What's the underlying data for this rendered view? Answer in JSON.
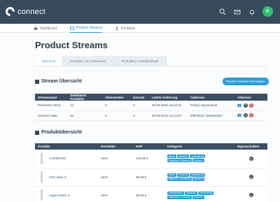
{
  "app": {
    "brand": "connect",
    "user_initial": "R"
  },
  "topbar_icons": [
    "search-icon",
    "mail-icon",
    "bell-icon"
  ],
  "nav": [
    {
      "label": "Dashboard",
      "icon": "home-icon",
      "active": false
    },
    {
      "label": "Product Streams",
      "icon": "stream-icon",
      "active": true
    },
    {
      "label": "Kontakte",
      "icon": "contacts-icon",
      "active": false
    }
  ],
  "page": {
    "title": "Product Streams"
  },
  "tabs": [
    {
      "label": "Übersicht",
      "active": true
    },
    {
      "label": "Produkte von Lieferanten",
      "active": false
    },
    {
      "label": "Produkte in Händlershops",
      "active": false
    }
  ],
  "stream_section": {
    "title": "Stream Übersicht",
    "add_button": "Product Stream hinzufügen",
    "columns": [
      "Streamname",
      "Selektierte Produkte",
      "Abonnenten",
      "Umsatz",
      "Letzte Änderung",
      "Optionen",
      "Aktionen"
    ],
    "rows": [
      {
        "name": "Promotion 2015",
        "selected": "12",
        "subscribers": "0",
        "revenue": "0",
        "changed": "03.08.2015 16:14:10",
        "options": "Privat | Dynamisch"
      },
      {
        "name": "Sommer Sale",
        "selected": "34",
        "subscribers": "0",
        "revenue": "0",
        "changed": "03.08.2015 16:14:27",
        "options": "Öffentlich | Dynamisch"
      }
    ]
  },
  "product_section": {
    "title": "Produktübersicht",
    "columns": [
      "Produkt",
      "Hersteller",
      "HVP",
      "Kategorie",
      "Eigenschaften"
    ],
    "rows": [
      {
        "name": "CARBONIO",
        "manufacturer": "LEKI",
        "price": "149,95 €",
        "tags": [
          "Bikes",
          "Zubehör",
          "Ausrüstung",
          "Wäsche & Zubehör",
          "Deutsch"
        ]
      },
      {
        "name": "Fast Vario S",
        "manufacturer": "LEKI",
        "price": "99,95 €",
        "tags": [
          "Bikes",
          "Zubehör",
          "Ausrüstung",
          "Wäsche & Zubehör",
          "Deutsch"
        ]
      },
      {
        "name": "Aspen Retro S",
        "manufacturer": "LEKI",
        "price": "89,95 €",
        "tags": [
          "Handschuhe",
          "Zubehör",
          "Ausrüstung",
          "Wäsche & Zubehör",
          "Deutsch"
        ]
      }
    ]
  },
  "colors": {
    "topbar": "#374a5c",
    "accent": "#2a9bd8",
    "delete": "#e24c4c",
    "table_header": "#3b4e62"
  }
}
